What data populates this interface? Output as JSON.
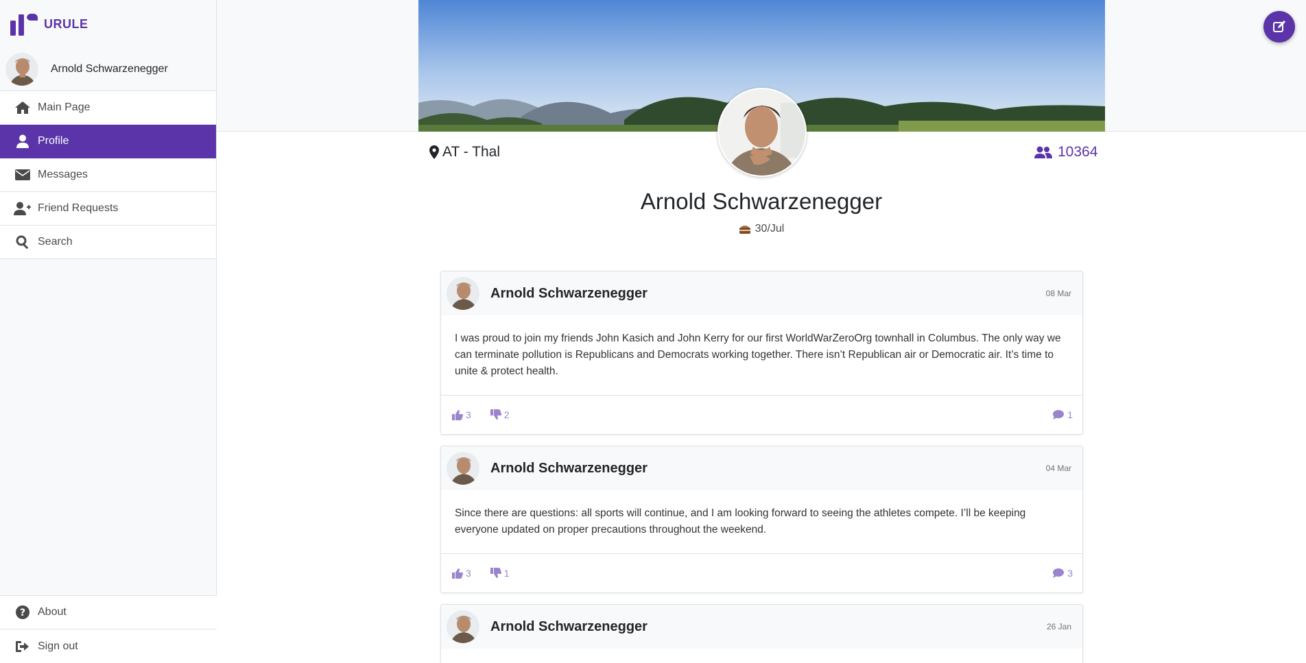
{
  "app": {
    "brand_name": "URULE",
    "accent_color": "#5a34a8"
  },
  "sidebar": {
    "user_name": "Arnold Schwarzenegger",
    "items": [
      {
        "label": "Main Page",
        "icon": "home-icon"
      },
      {
        "label": "Profile",
        "icon": "user-icon",
        "active": true
      },
      {
        "label": "Messages",
        "icon": "envelope-icon"
      },
      {
        "label": "Friend Requests",
        "icon": "user-plus-icon"
      },
      {
        "label": "Search",
        "icon": "search-icon"
      }
    ],
    "bottom_items": [
      {
        "label": "About",
        "icon": "question-circle-icon"
      },
      {
        "label": "Sign out",
        "icon": "sign-out-icon"
      }
    ]
  },
  "profile": {
    "name": "Arnold Schwarzenegger",
    "location": "AT - Thal",
    "friends_count": "10364",
    "birthday": "30/Jul"
  },
  "posts": [
    {
      "author": "Arnold Schwarzenegger",
      "date": "08 Mar",
      "text": "I was proud to join my friends John Kasich and John Kerry for our first WorldWarZeroOrg townhall in Columbus. The only way we can terminate pollution is Republicans and Democrats working together. There isn’t Republican air or Democratic air. It’s time to unite & protect health.",
      "likes": "3",
      "dislikes": "2",
      "comments": "1"
    },
    {
      "author": "Arnold Schwarzenegger",
      "date": "04 Mar",
      "text": "Since there are questions: all sports will continue, and I am looking forward to seeing the athletes compete. I’ll be keeping everyone updated on proper precautions throughout the weekend.",
      "likes": "3",
      "dislikes": "1",
      "comments": "3"
    },
    {
      "author": "Arnold Schwarzenegger",
      "date": "26 Jan",
      "text": "",
      "likes": "",
      "dislikes": "",
      "comments": ""
    }
  ]
}
